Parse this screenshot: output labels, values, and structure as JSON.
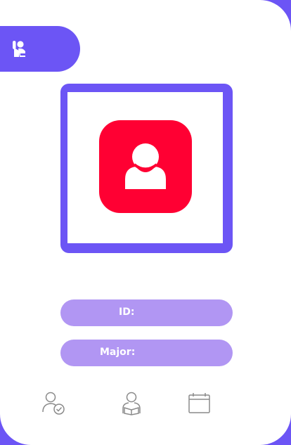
{
  "colors": {
    "background": "#6c55f5",
    "accent": "#6c55f5",
    "avatar": "#ff0033",
    "pill": "#b196f3",
    "icon_gray": "#8a8a8a"
  },
  "header": {
    "icon": "raise-hand-icon"
  },
  "photo": {
    "icon": "user-avatar-icon"
  },
  "fields": {
    "id_label": "ID:",
    "major_label": "Major:"
  },
  "bottom_nav": [
    {
      "icon": "user-check-icon"
    },
    {
      "icon": "user-reading-icon"
    },
    {
      "icon": "calendar-icon"
    }
  ]
}
